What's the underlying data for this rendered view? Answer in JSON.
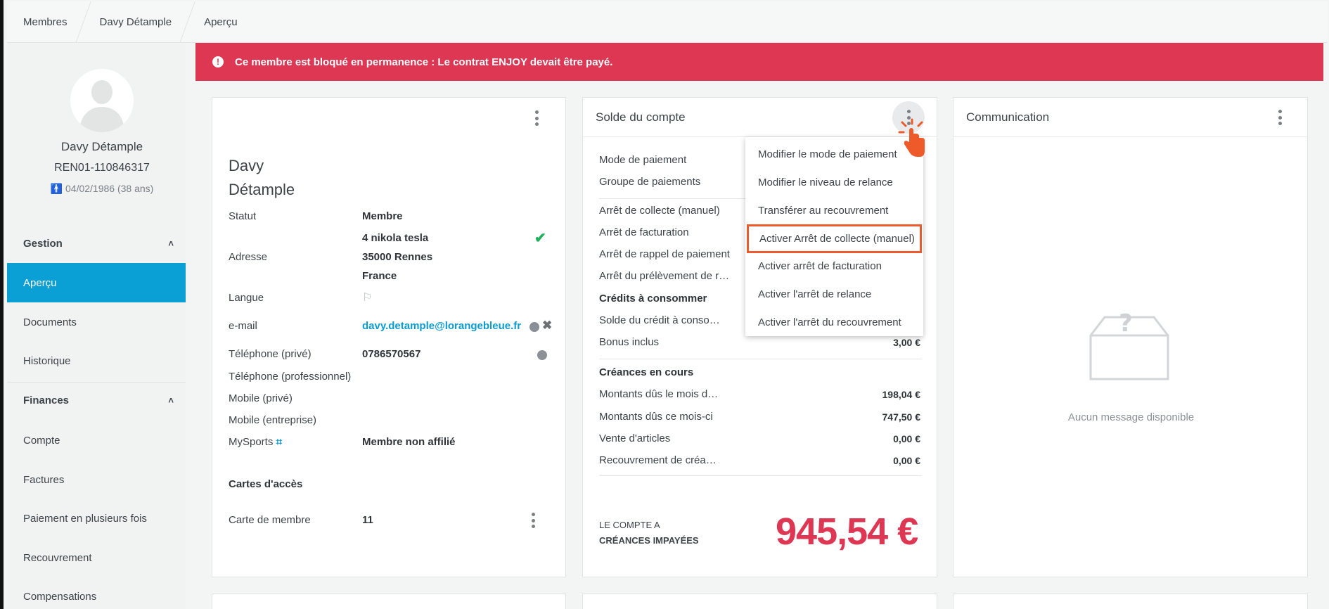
{
  "breadcrumb": [
    "Membres",
    "Davy Détample",
    "Aperçu"
  ],
  "alert": {
    "text": "Ce membre est bloqué en permanence : Le contrat ENJOY devait être payé."
  },
  "profile": {
    "name": "Davy Détample",
    "id": "REN01-110846317",
    "dob": "04/02/1986 (38 ans)"
  },
  "sidebar": {
    "sections": [
      {
        "label": "Gestion"
      },
      {
        "label": "Finances"
      }
    ],
    "gestion_items": [
      "Aperçu",
      "Documents",
      "Historique"
    ],
    "finances_items": [
      "Compte",
      "Factures",
      "Paiement en plusieurs fois",
      "Recouvrement",
      "Compensations"
    ]
  },
  "member_card": {
    "first_name": "Davy",
    "last_name": "Détample",
    "rows": {
      "statut_label": "Statut",
      "statut_val": "Membre",
      "adresse_label": "Adresse",
      "addr1": "4 nikola tesla",
      "addr2": "35000 Rennes",
      "addr3": "France",
      "langue_label": "Langue",
      "email_label": "e-mail",
      "email_val": "davy.detample@lorangebleue.fr",
      "tel_label": "Téléphone (privé)",
      "tel_val": "0786570567",
      "telpro_label": "Téléphone (professionnel)",
      "mob_label": "Mobile (privé)",
      "mobent_label": "Mobile (entreprise)",
      "mysports_label": "MySports",
      "mysports_val": "Membre non affilié",
      "cartes_title": "Cartes d'accès",
      "carte_label": "Carte de membre",
      "carte_val": "11"
    }
  },
  "solde_card": {
    "title": "Solde du compte",
    "rows": [
      "Mode de paiement",
      "Groupe de paiements",
      "Arrêt de collecte (manuel)",
      "Arrêt de facturation",
      "Arrêt de rappel de paiement",
      "Arrêt du prélèvement de r…"
    ],
    "credits_title": "Crédits à consommer",
    "credits_rows": [
      "Solde du crédit à conso…",
      "Bonus inclus"
    ],
    "bonus_val": "3,00 €",
    "creances_title": "Créances en cours",
    "creances_rows": [
      {
        "label": "Montants dûs le mois d…",
        "val": "198,04 €"
      },
      {
        "label": "Montants dûs ce mois-ci",
        "val": "747,50 €"
      },
      {
        "label": "Vente d'articles",
        "val": "0,00 €"
      },
      {
        "label": "Recouvrement de créa…",
        "val": "0,00 €"
      }
    ],
    "footer_l1": "LE COMPTE A",
    "footer_l2": "CRÉANCES IMPAYÉES",
    "total": "945,54 €"
  },
  "menu": {
    "items": [
      "Modifier le mode de paiement",
      "Modifier le niveau de relance",
      "Transférer au recouvrement",
      "Activer Arrêt de collecte (manuel)",
      "Activer arrêt de facturation",
      "Activer l'arrêt de relance",
      "Activer l'arrêt du recouvrement"
    ]
  },
  "communication": {
    "title": "Communication",
    "empty": "Aucun message disponible"
  },
  "colors": {
    "accent": "#0aa0d6",
    "alert": "#dd3753",
    "highlight": "#ee5a2c",
    "success": "#1fb15a"
  }
}
